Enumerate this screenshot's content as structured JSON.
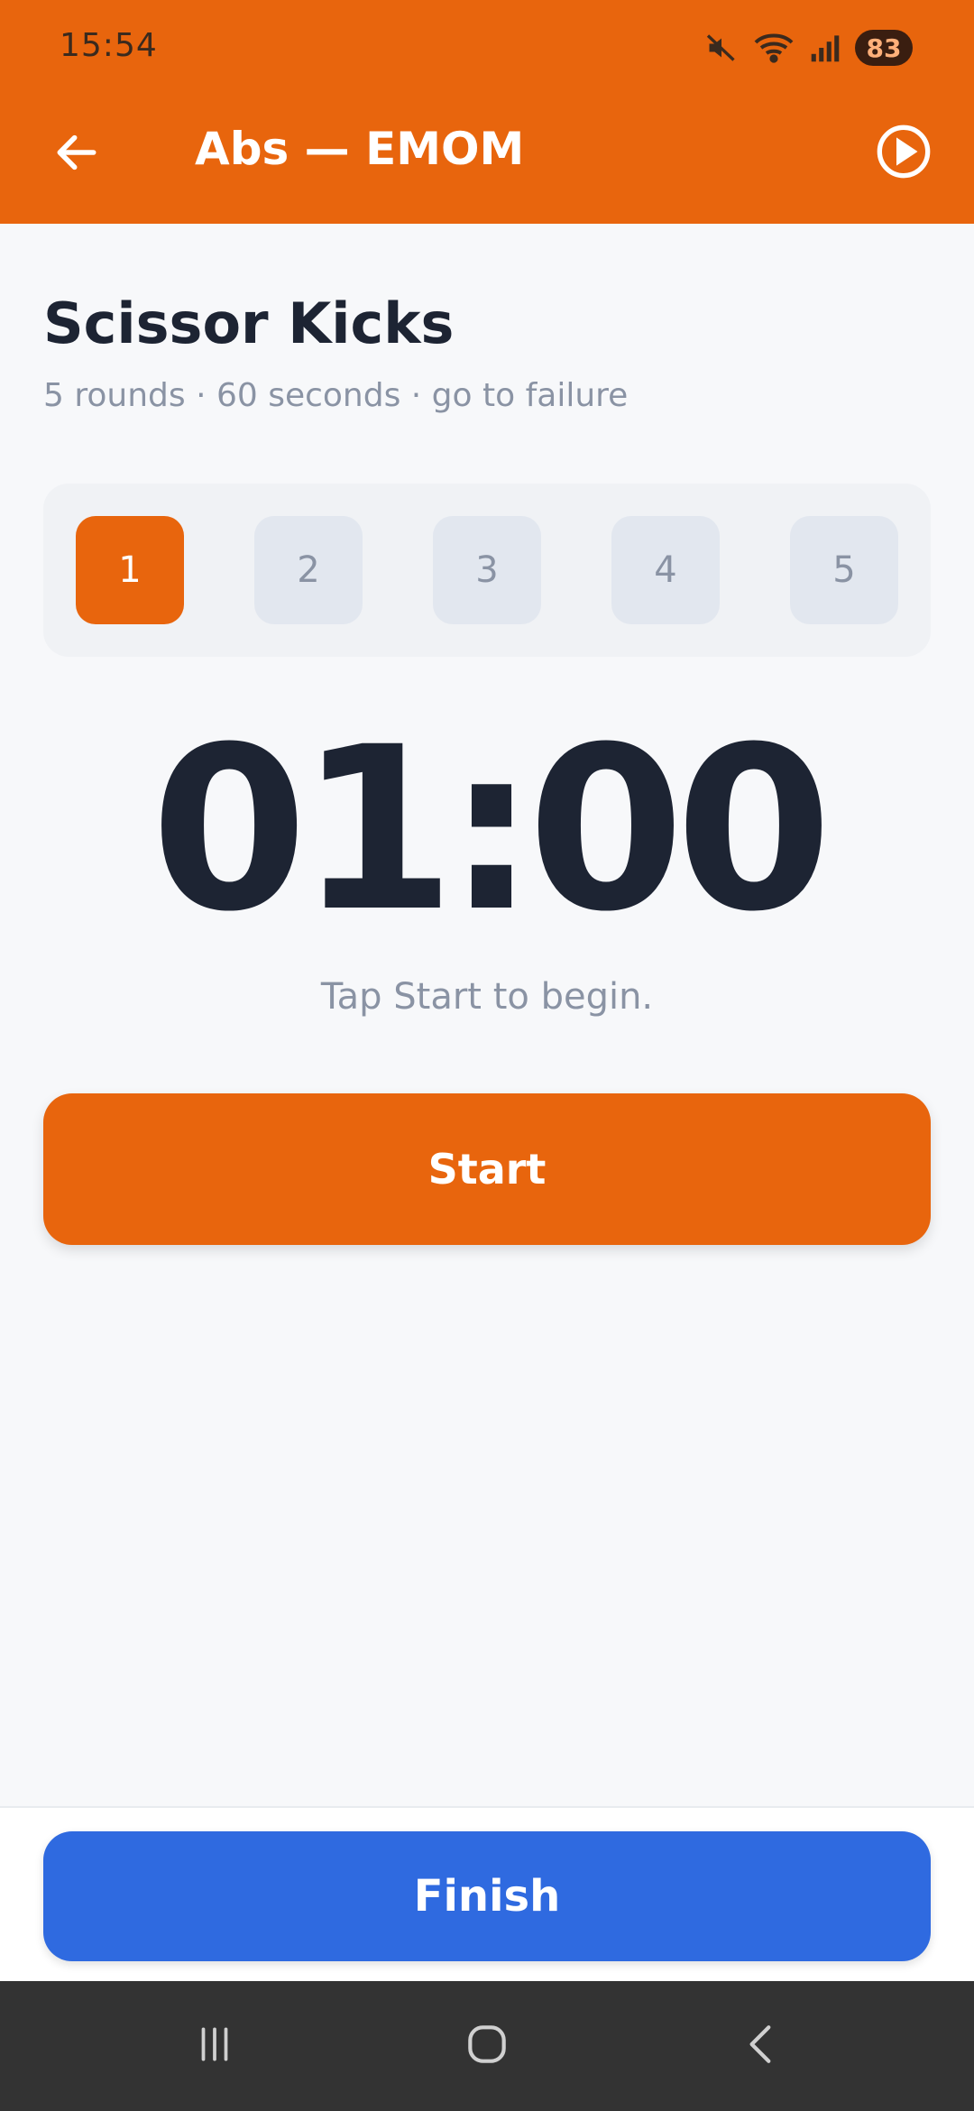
{
  "status_bar": {
    "time": "15:54",
    "battery": "83",
    "icons": [
      "mute-icon",
      "wifi-icon",
      "signal-icon",
      "battery-icon"
    ]
  },
  "app_bar": {
    "title": "Abs — EMOM",
    "icons": [
      "back-arrow-icon",
      "play-circle-icon"
    ]
  },
  "exercise": {
    "title": "Scissor Kicks",
    "subtitle": "5 rounds · 60 seconds · go to failure"
  },
  "rounds": {
    "items": [
      "1",
      "2",
      "3",
      "4",
      "5"
    ],
    "active": "1"
  },
  "timer": {
    "value": "01:00",
    "hint": "Tap Start to begin."
  },
  "actions": {
    "start_label": "Start",
    "finish_label": "Finish"
  },
  "colors": {
    "accent": "#e8650d",
    "finish": "#2f6ae0",
    "text_dark": "#1d2433",
    "text_muted": "#8a93a4"
  },
  "nav_bar": {
    "icons": [
      "recent-apps-icon",
      "home-icon",
      "back-icon"
    ]
  }
}
